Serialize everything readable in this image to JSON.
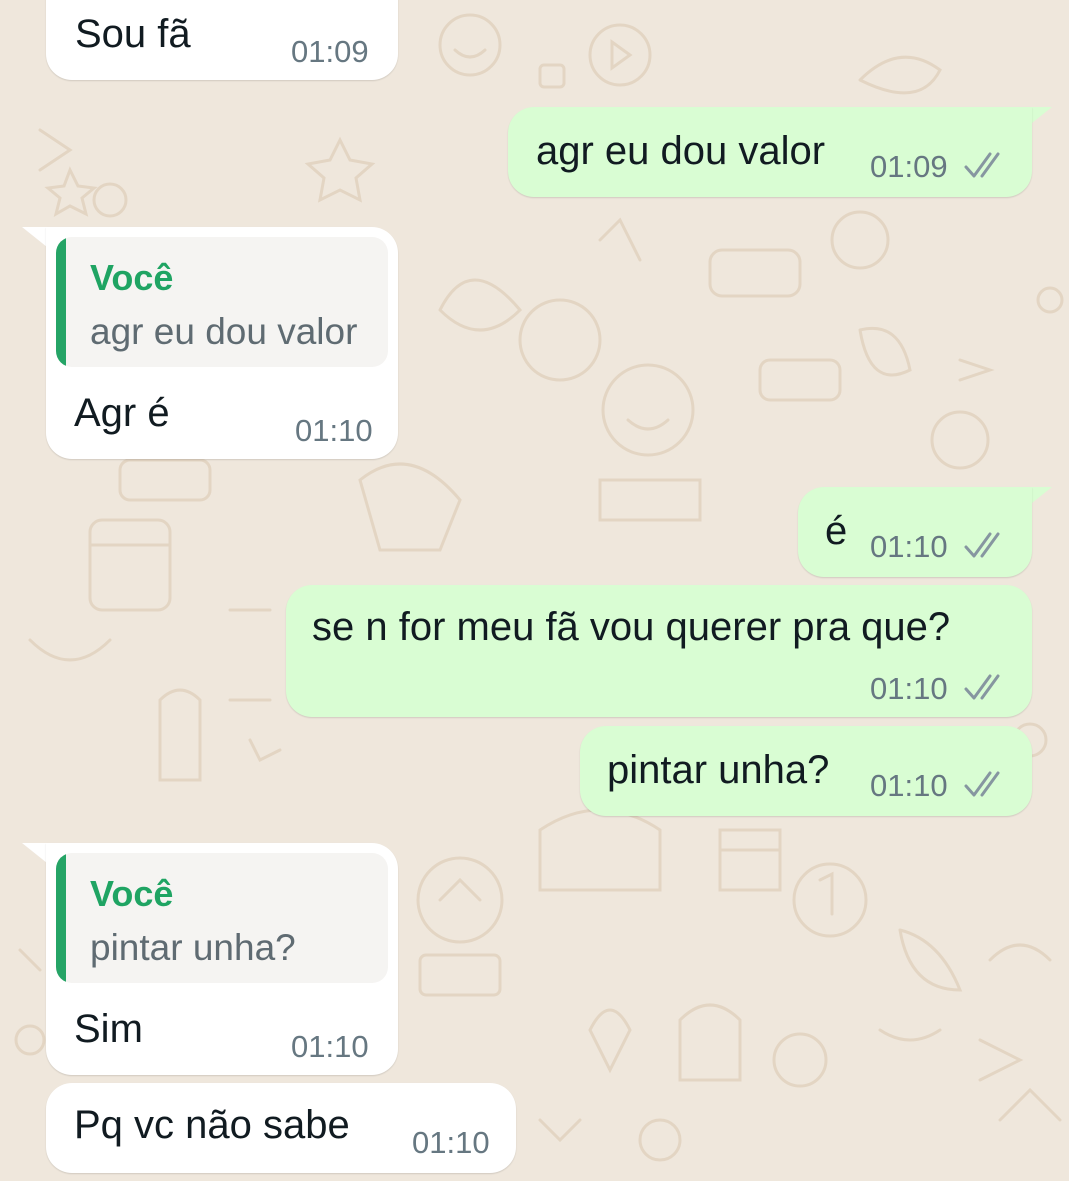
{
  "messages": [
    {
      "direction": "incoming",
      "text": "Sou fã",
      "time": "01:09"
    },
    {
      "direction": "outgoing",
      "text": "agr eu dou valor",
      "time": "01:09",
      "status": "double-check-icon"
    },
    {
      "direction": "incoming",
      "reply_to": {
        "author": "Você",
        "text": "agr eu dou valor"
      },
      "text": "Agr é",
      "time": "01:10"
    },
    {
      "direction": "outgoing",
      "text": "é",
      "time": "01:10",
      "status": "double-check-icon"
    },
    {
      "direction": "outgoing",
      "text": "se n for meu fã vou querer pra que?",
      "time": "01:10",
      "status": "double-check-icon"
    },
    {
      "direction": "outgoing",
      "text": "pintar unha?",
      "time": "01:10",
      "status": "double-check-icon"
    },
    {
      "direction": "incoming",
      "reply_to": {
        "author": "Você",
        "text": "pintar unha?"
      },
      "text": "Sim",
      "time": "01:10"
    },
    {
      "direction": "incoming",
      "text": "Pq vc não sabe",
      "time": "01:10"
    }
  ],
  "colors": {
    "background": "#efe7dc",
    "incoming_bubble": "#ffffff",
    "outgoing_bubble": "#d9fdd3",
    "quote_accent": "#25a466",
    "timestamp": "#667781"
  }
}
